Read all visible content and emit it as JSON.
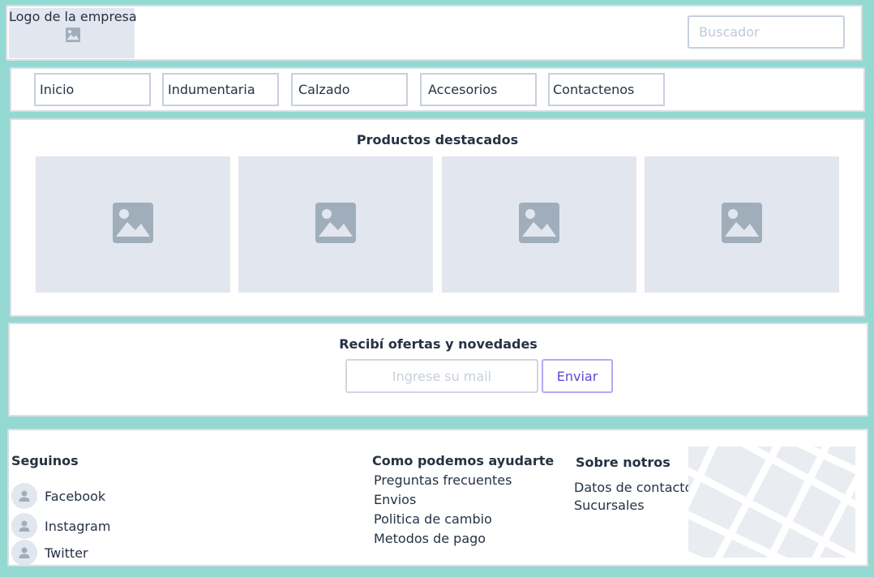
{
  "header": {
    "logo_label": "Logo de la empresa",
    "search_placeholder": "Buscador"
  },
  "nav": {
    "items": [
      {
        "label": "Inicio"
      },
      {
        "label": "Indumentaria"
      },
      {
        "label": "Calzado"
      },
      {
        "label": "Accesorios"
      },
      {
        "label": "Contactenos"
      }
    ]
  },
  "featured": {
    "title": "Productos destacados",
    "products": [
      {
        "icon": "image-icon"
      },
      {
        "icon": "image-icon"
      },
      {
        "icon": "image-icon"
      },
      {
        "icon": "image-icon"
      }
    ]
  },
  "newsletter": {
    "title": "Recibí ofertas y novedades",
    "email_placeholder": "Ingrese su mail",
    "send_label": "Enviar"
  },
  "footer": {
    "social": {
      "title": "Seguinos",
      "items": [
        {
          "label": "Facebook",
          "icon": "user-icon"
        },
        {
          "label": "Instagram",
          "icon": "user-icon"
        },
        {
          "label": "Twitter",
          "icon": "user-icon"
        }
      ]
    },
    "help": {
      "title": "Como podemos ayudarte",
      "links": [
        "Preguntas frecuentes",
        "Envios",
        "Politica de cambio",
        "Metodos de pago"
      ]
    },
    "about": {
      "title": "Sobre notros",
      "links": [
        "Datos de contacto",
        "Sucursales"
      ]
    },
    "map_icon": "map-icon"
  },
  "colors": {
    "background": "#93d9d1",
    "placeholder_fill": "#e2e6ee",
    "icon": "#a0aebb",
    "accent": "#5a4ad8"
  }
}
